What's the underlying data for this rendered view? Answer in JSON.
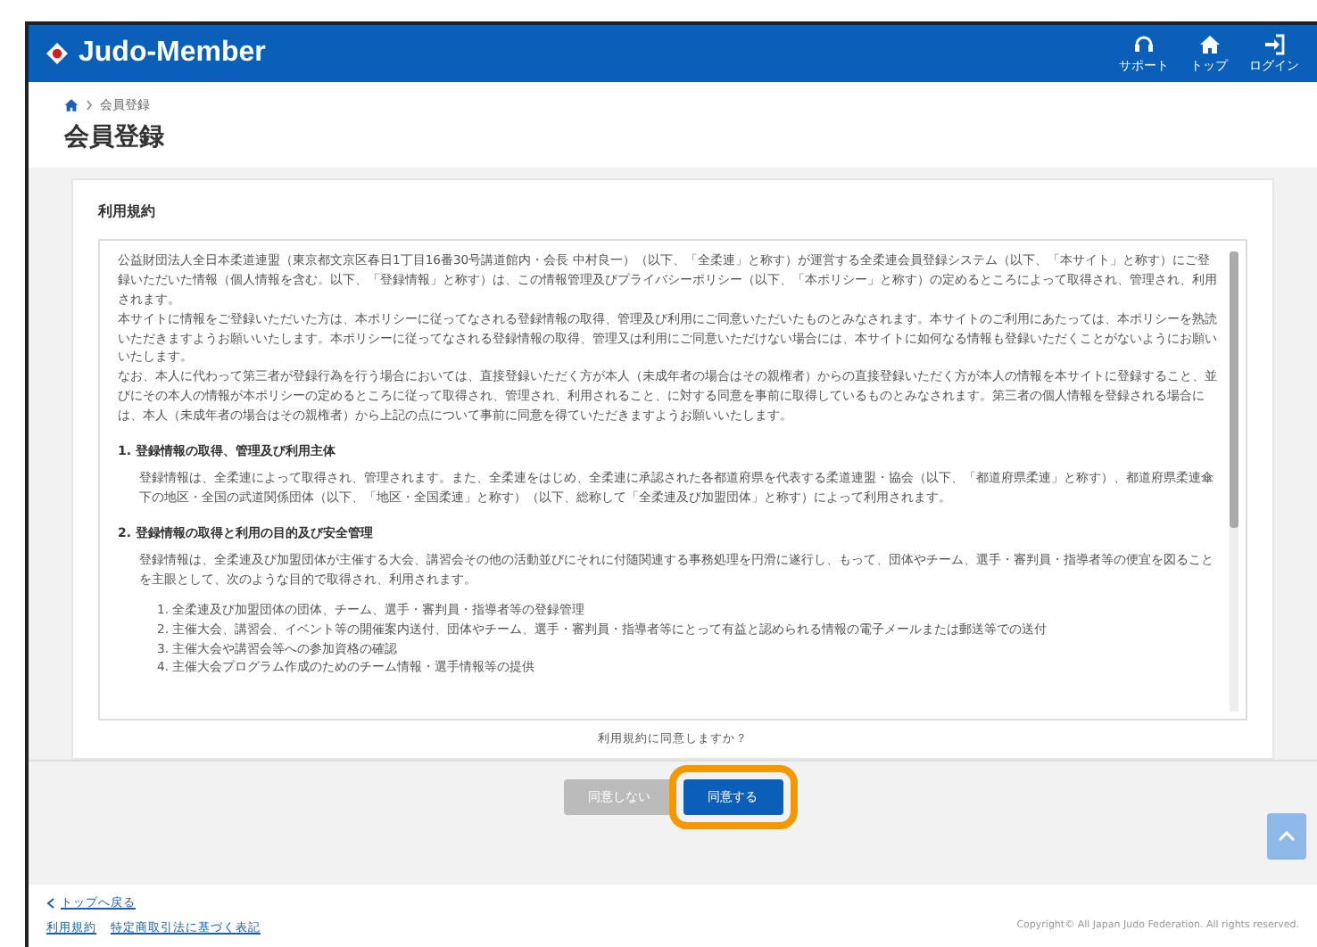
{
  "header": {
    "brand": "Judo-Member",
    "nav": [
      {
        "kind": "support",
        "label": "サポート"
      },
      {
        "kind": "top",
        "label": "トップ"
      },
      {
        "kind": "login",
        "label": "ログイン"
      }
    ]
  },
  "breadcrumb": {
    "current": "会員登録"
  },
  "page_title": "会員登録",
  "terms": {
    "title": "利用規約",
    "paragraphs": [
      "公益財団法人全日本柔道連盟（東京都文京区春日1丁目16番30号講道館内・会長 中村良一）（以下、「全柔連」と称す）が運営する全柔連会員登録システム（以下、「本サイト」と称す）にご登録いただいた情報（個人情報を含む。以下、「登録情報」と称す）は、この情報管理及びプライバシーポリシー（以下、「本ポリシー」と称す）の定めるところによって取得され、管理され、利用されます。",
      "本サイトに情報をご登録いただいた方は、本ポリシーに従ってなされる登録情報の取得、管理及び利用にご同意いただいたものとみなされます。本サイトのご利用にあたっては、本ポリシーを熟読いただきますようお願いいたします。本ポリシーに従ってなされる登録情報の取得、管理又は利用にご同意いただけない場合には、本サイトに如何なる情報も登録いただくことがないようにお願いいたします。",
      "なお、本人に代わって第三者が登録行為を行う場合においては、直接登録いただく方が本人（未成年者の場合はその親権者）からの直接登録いただく方が本人の情報を本サイトに登録すること、並びにその本人の情報が本ポリシーの定めるところに従って取得され、管理され、利用されること、に対する同意を事前に取得しているものとみなされます。第三者の個人情報を登録される場合には、本人（未成年者の場合はその親権者）から上記の点について事前に同意を得ていただきますようお願いいたします。"
    ],
    "sections": [
      {
        "heading": "1. 登録情報の取得、管理及び利用主体",
        "text": "登録情報は、全柔連によって取得され、管理されます。また、全柔連をはじめ、全柔連に承認された各都道府県を代表する柔道連盟・協会（以下、「都道府県柔連」と称す）、都道府県柔連傘下の地区・全国の武道関係団体（以下、「地区・全国柔連」と称す）（以下、総称して「全柔連及び加盟団体」と称す）によって利用されます。"
      },
      {
        "heading": "2. 登録情報の取得と利用の目的及び安全管理",
        "text": "登録情報は、全柔連及び加盟団体が主催する大会、講習会その他の活動並びにそれに付随関連する事務処理を円滑に遂行し、もって、団体やチーム、選手・審判員・指導者等の便宜を図ることを主眼として、次のような目的で取得され、利用されます。",
        "items": [
          "1. 全柔連及び加盟団体の団体、チーム、選手・審判員・指導者等の登録管理",
          "2. 主催大会、講習会、イベント等の開催案内送付、団体やチーム、選手・審判員・指導者等にとって有益と認められる情報の電子メールまたは郵送等での送付",
          "3. 主催大会や講習会等への参加資格の確認",
          "4. 主催大会プログラム作成のためのチーム情報・選手情報等の提供"
        ]
      }
    ],
    "question": "利用規約に同意しますか？"
  },
  "buttons": [
    {
      "kind": "secondary",
      "label": "同意しない",
      "highlighted": false
    },
    {
      "kind": "primary",
      "label": "同意する",
      "highlighted": true
    }
  ],
  "footer": {
    "back_link": "トップへ戻る",
    "links": [
      "利用規約",
      "特定商取引法に基づく表記"
    ],
    "copyright": "Copyright© All Japan Judo Federation. All rights reserved."
  }
}
